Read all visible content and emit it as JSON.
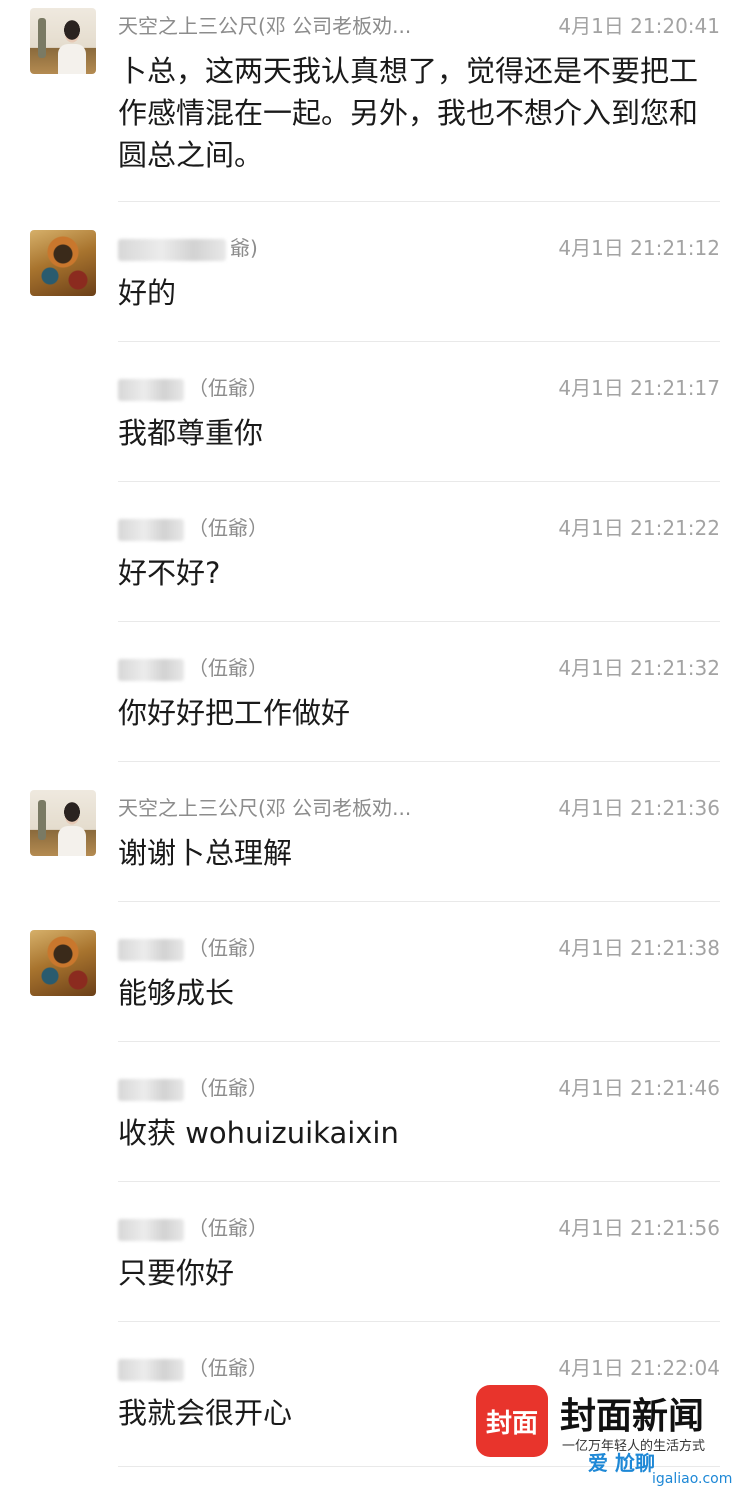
{
  "messages": [
    {
      "sender": "天空之上三公尺(邓 公司老板劝...",
      "sender_blurred": false,
      "avatar": "woman-avatar",
      "time": "4月1日 21:20:41",
      "text": "卜总，这两天我认真想了，觉得还是不要把工作感情混在一起。另外，我也不想介入到您和圆总之间。"
    },
    {
      "sender": "爺)",
      "sender_blurred": true,
      "avatar": "deity-avatar",
      "time": "4月1日 21:21:12",
      "text": "好的"
    },
    {
      "sender": "（伍爺）",
      "sender_blurred": true,
      "avatar": "",
      "time": "4月1日 21:21:17",
      "text": "我都尊重你"
    },
    {
      "sender": "（伍爺）",
      "sender_blurred": true,
      "avatar": "",
      "time": "4月1日 21:21:22",
      "text": "好不好?"
    },
    {
      "sender": "（伍爺）",
      "sender_blurred": true,
      "avatar": "",
      "time": "4月1日 21:21:32",
      "text": "你好好把工作做好"
    },
    {
      "sender": "天空之上三公尺(邓 公司老板劝...",
      "sender_blurred": false,
      "avatar": "woman-avatar",
      "time": "4月1日 21:21:36",
      "text": "谢谢卜总理解"
    },
    {
      "sender": "（伍爺）",
      "sender_blurred": true,
      "avatar": "deity-avatar",
      "time": "4月1日 21:21:38",
      "text": "能够成长"
    },
    {
      "sender": "（伍爺）",
      "sender_blurred": true,
      "avatar": "",
      "time": "4月1日 21:21:46",
      "text": "收获 wohuizuikaixin"
    },
    {
      "sender": "（伍爺）",
      "sender_blurred": true,
      "avatar": "",
      "time": "4月1日 21:21:56",
      "text": "只要你好"
    },
    {
      "sender": "（伍爺）",
      "sender_blurred": true,
      "avatar": "",
      "time": "4月1日 21:22:04",
      "text": "我就会很开心"
    }
  ],
  "watermark": {
    "logo_text": "封面",
    "name": "封面新闻",
    "slogan": "一亿万年轻人的生活方式",
    "site_cn": "爱 尬聊",
    "site_url": "igaliao.com"
  }
}
